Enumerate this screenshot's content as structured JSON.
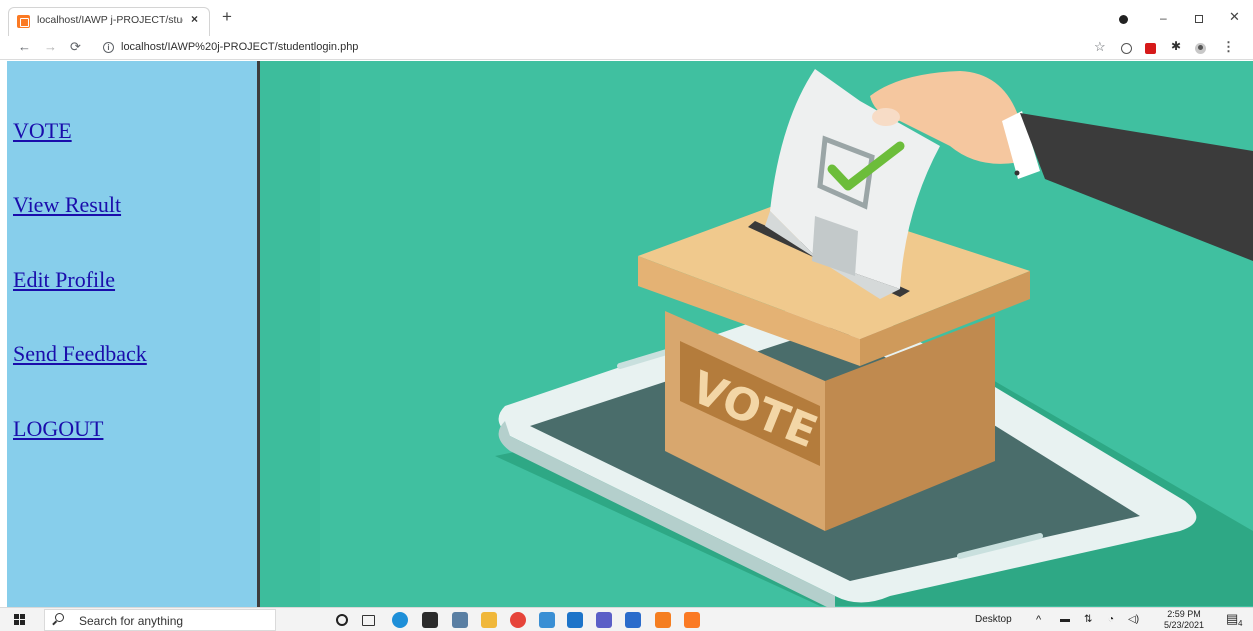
{
  "browser": {
    "tab_title": "localhost/IAWP j-PROJECT/stude",
    "tab_close": "×",
    "new_tab": "+",
    "url": "localhost/IAWP%20j-PROJECT/studentlogin.php",
    "window_min": "–",
    "window_close": "✕"
  },
  "sidebar": {
    "links": [
      {
        "label": "VOTE"
      },
      {
        "label": "View Result"
      },
      {
        "label": "Edit Profile"
      },
      {
        "label": "Send Feedback"
      },
      {
        "label": "LOGOUT"
      }
    ]
  },
  "hero": {
    "box_label": "VOTE"
  },
  "taskbar": {
    "search_placeholder": "Search for anything",
    "desktop_label": "Desktop",
    "time": "2:59 PM",
    "date": "5/23/2021",
    "notification_count": "4"
  },
  "colors": {
    "sidebar_bg": "#87ceeb",
    "hero_bg": "#3dbd9c",
    "link_color": "#1a0dab"
  }
}
